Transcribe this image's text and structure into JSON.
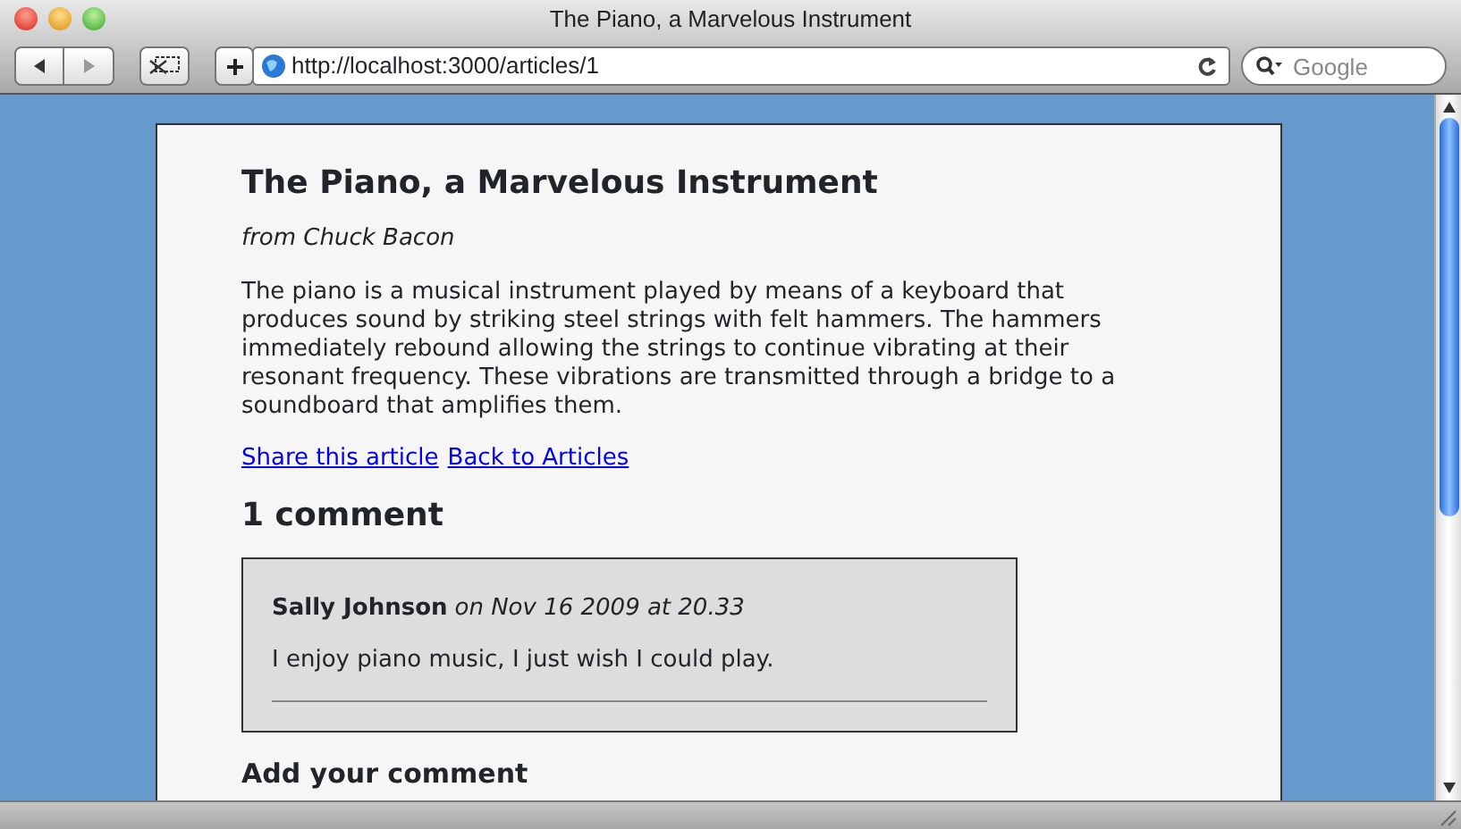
{
  "window": {
    "title": "The Piano, a Marvelous Instrument"
  },
  "toolbar": {
    "url": "http://localhost:3000/articles/1",
    "search": {
      "placeholder": "Google"
    }
  },
  "article": {
    "title": "The Piano, a Marvelous Instrument",
    "byline": "from Chuck Bacon",
    "body": "The piano is a musical instrument played by means of a keyboard that produces sound by striking steel strings with felt hammers. The hammers immediately rebound allowing the strings to continue vibrating at their resonant frequency. These vibrations are transmitted through a bridge to a soundboard that amplifies them.",
    "links": [
      "Share this article",
      "Back to Articles"
    ],
    "comments_heading": "1 comment",
    "comments": [
      {
        "author": "Sally Johnson",
        "date": "on Nov 16 2009 at 20.33",
        "text": "I enjoy piano music, I just wish I could play."
      }
    ],
    "add_comment_heading": "Add your comment"
  }
}
